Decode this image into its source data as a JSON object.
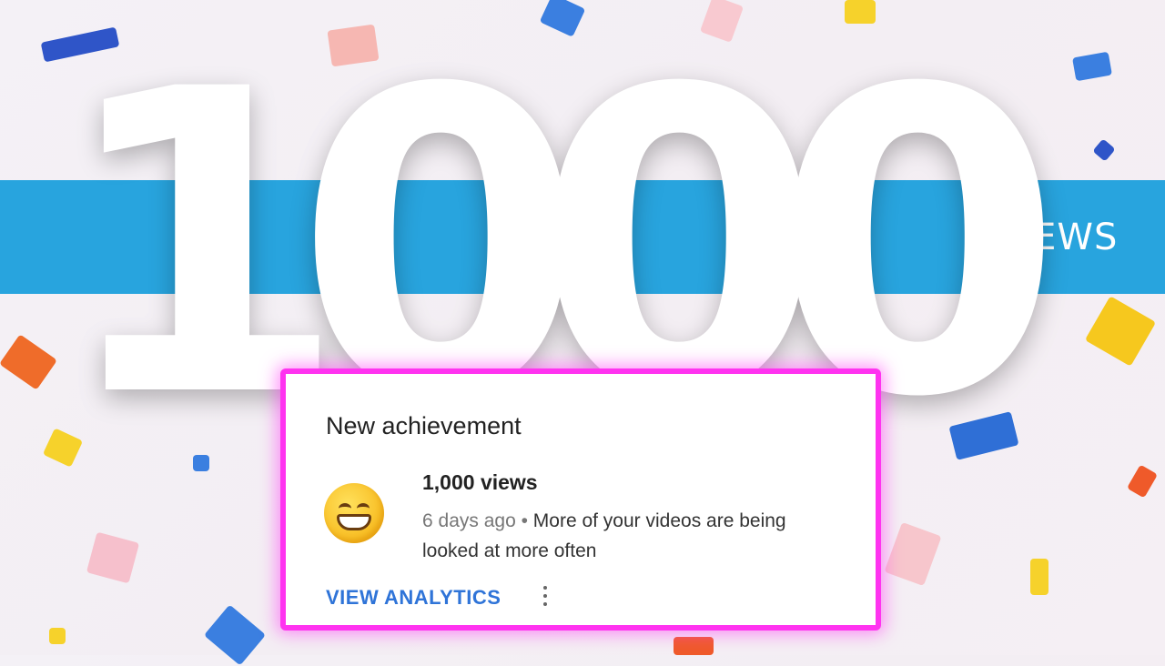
{
  "banner": {
    "big_number": "1000",
    "label": "VIEWS"
  },
  "card": {
    "title": "New achievement",
    "emoji_icon": "grinning-face-emoji",
    "achievement": "1,000 views",
    "time": "6 days ago",
    "separator": " • ",
    "description": "More of your videos are being looked at more often",
    "action_label": "VIEW ANALYTICS"
  },
  "colors": {
    "stripe": "#28a4de",
    "card_border": "#ff33f0",
    "action": "#2f74d8"
  }
}
